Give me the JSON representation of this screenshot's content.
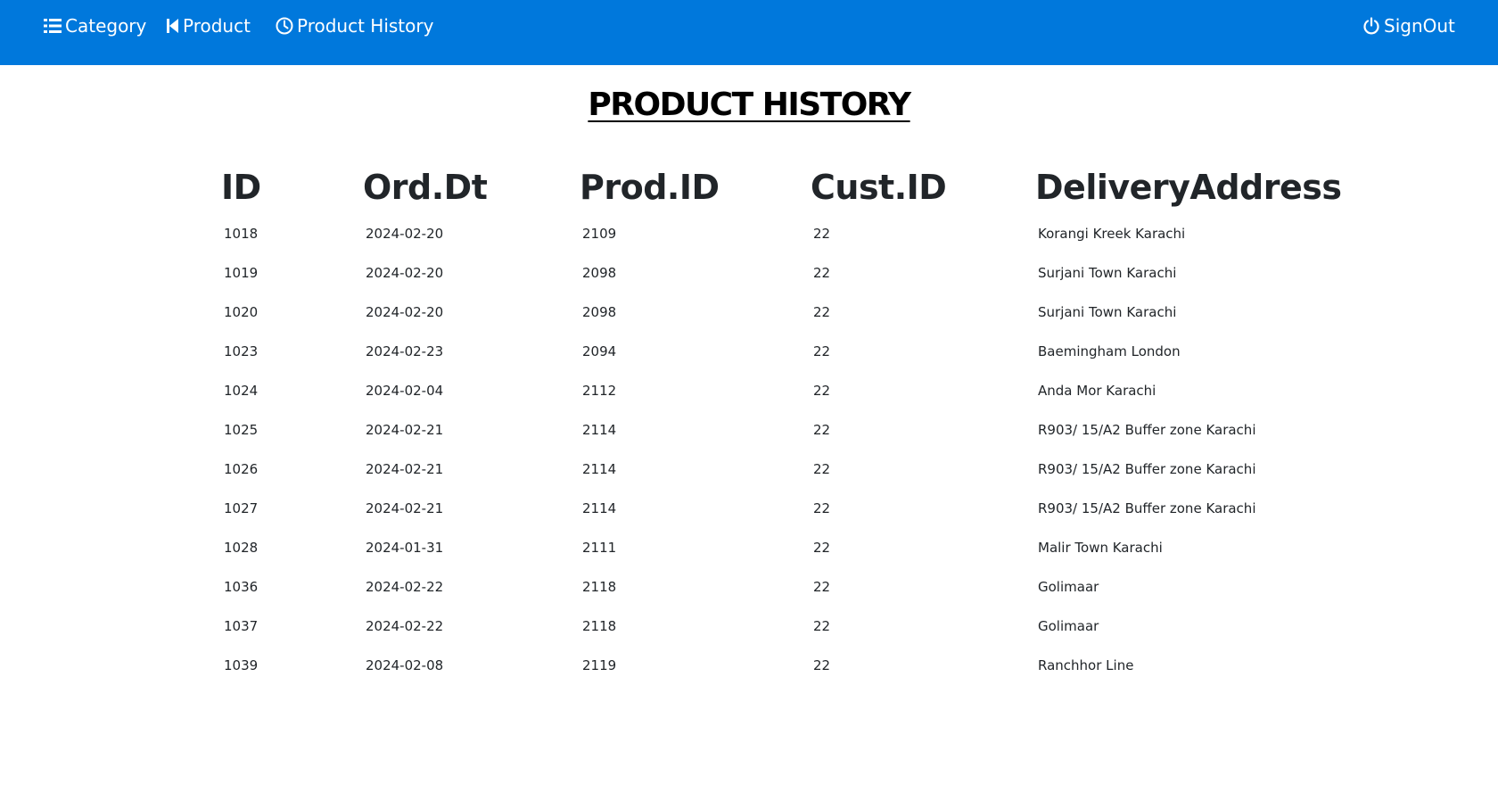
{
  "nav": {
    "category": {
      "label": "Category",
      "icon": "list-icon"
    },
    "product": {
      "label": "Product",
      "icon": "skip-back-icon"
    },
    "history": {
      "label": "Product History",
      "icon": "clock-icon"
    },
    "signout": {
      "label": "SignOut",
      "icon": "power-icon"
    },
    "background": "#0078dc"
  },
  "page": {
    "title": "PRODUCT HISTORY"
  },
  "table": {
    "headers": [
      "ID",
      "Ord.Dt",
      "Prod.ID",
      "Cust.ID",
      "DeliveryAddress"
    ],
    "rows": [
      [
        "1018",
        "2024-02-20",
        "2109",
        "22",
        "Korangi Kreek Karachi"
      ],
      [
        "1019",
        "2024-02-20",
        "2098",
        "22",
        "Surjani Town Karachi"
      ],
      [
        "1020",
        "2024-02-20",
        "2098",
        "22",
        "Surjani Town Karachi"
      ],
      [
        "1023",
        "2024-02-23",
        "2094",
        "22",
        "Baemingham London"
      ],
      [
        "1024",
        "2024-02-04",
        "2112",
        "22",
        "Anda Mor Karachi"
      ],
      [
        "1025",
        "2024-02-21",
        "2114",
        "22",
        "R903/ 15/A2 Buffer zone Karachi"
      ],
      [
        "1026",
        "2024-02-21",
        "2114",
        "22",
        "R903/ 15/A2 Buffer zone Karachi"
      ],
      [
        "1027",
        "2024-02-21",
        "2114",
        "22",
        "R903/ 15/A2 Buffer zone Karachi"
      ],
      [
        "1028",
        "2024-01-31",
        "2111",
        "22",
        "Malir Town Karachi"
      ],
      [
        "1036",
        "2024-02-22",
        "2118",
        "22",
        "Golimaar"
      ],
      [
        "1037",
        "2024-02-22",
        "2118",
        "22",
        "Golimaar"
      ],
      [
        "1039",
        "2024-02-08",
        "2119",
        "22",
        "Ranchhor Line"
      ]
    ]
  }
}
